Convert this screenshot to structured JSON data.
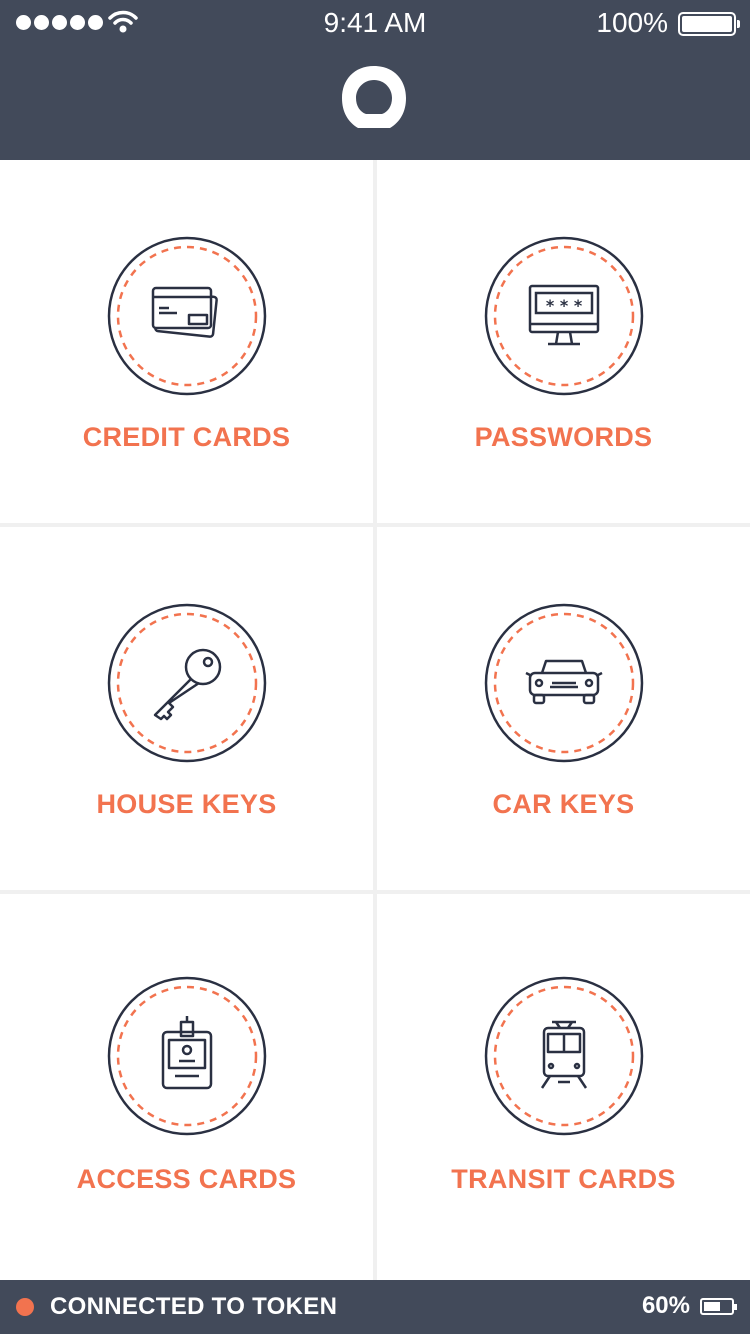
{
  "status_bar": {
    "time": "9:41 AM",
    "battery_percent": "100%",
    "signal_icon": "signal-dots-icon",
    "wifi_icon": "wifi-icon",
    "battery_icon": "battery-full-icon"
  },
  "header": {
    "logo_icon": "ring-logo-icon"
  },
  "tiles": [
    {
      "label": "CREDIT CARDS",
      "icon": "credit-cards-icon"
    },
    {
      "label": "PASSWORDS",
      "icon": "password-monitor-icon"
    },
    {
      "label": "HOUSE KEYS",
      "icon": "house-key-icon"
    },
    {
      "label": "CAR KEYS",
      "icon": "car-icon"
    },
    {
      "label": "ACCESS CARDS",
      "icon": "id-badge-icon"
    },
    {
      "label": "TRANSIT CARDS",
      "icon": "tram-icon"
    }
  ],
  "footer": {
    "status_text": "CONNECTED TO TOKEN",
    "battery_percent": "60%",
    "battery_level": 0.6
  },
  "colors": {
    "header_bg": "#424a5a",
    "accent": "#f2734f",
    "icon_stroke": "#2a3042"
  }
}
